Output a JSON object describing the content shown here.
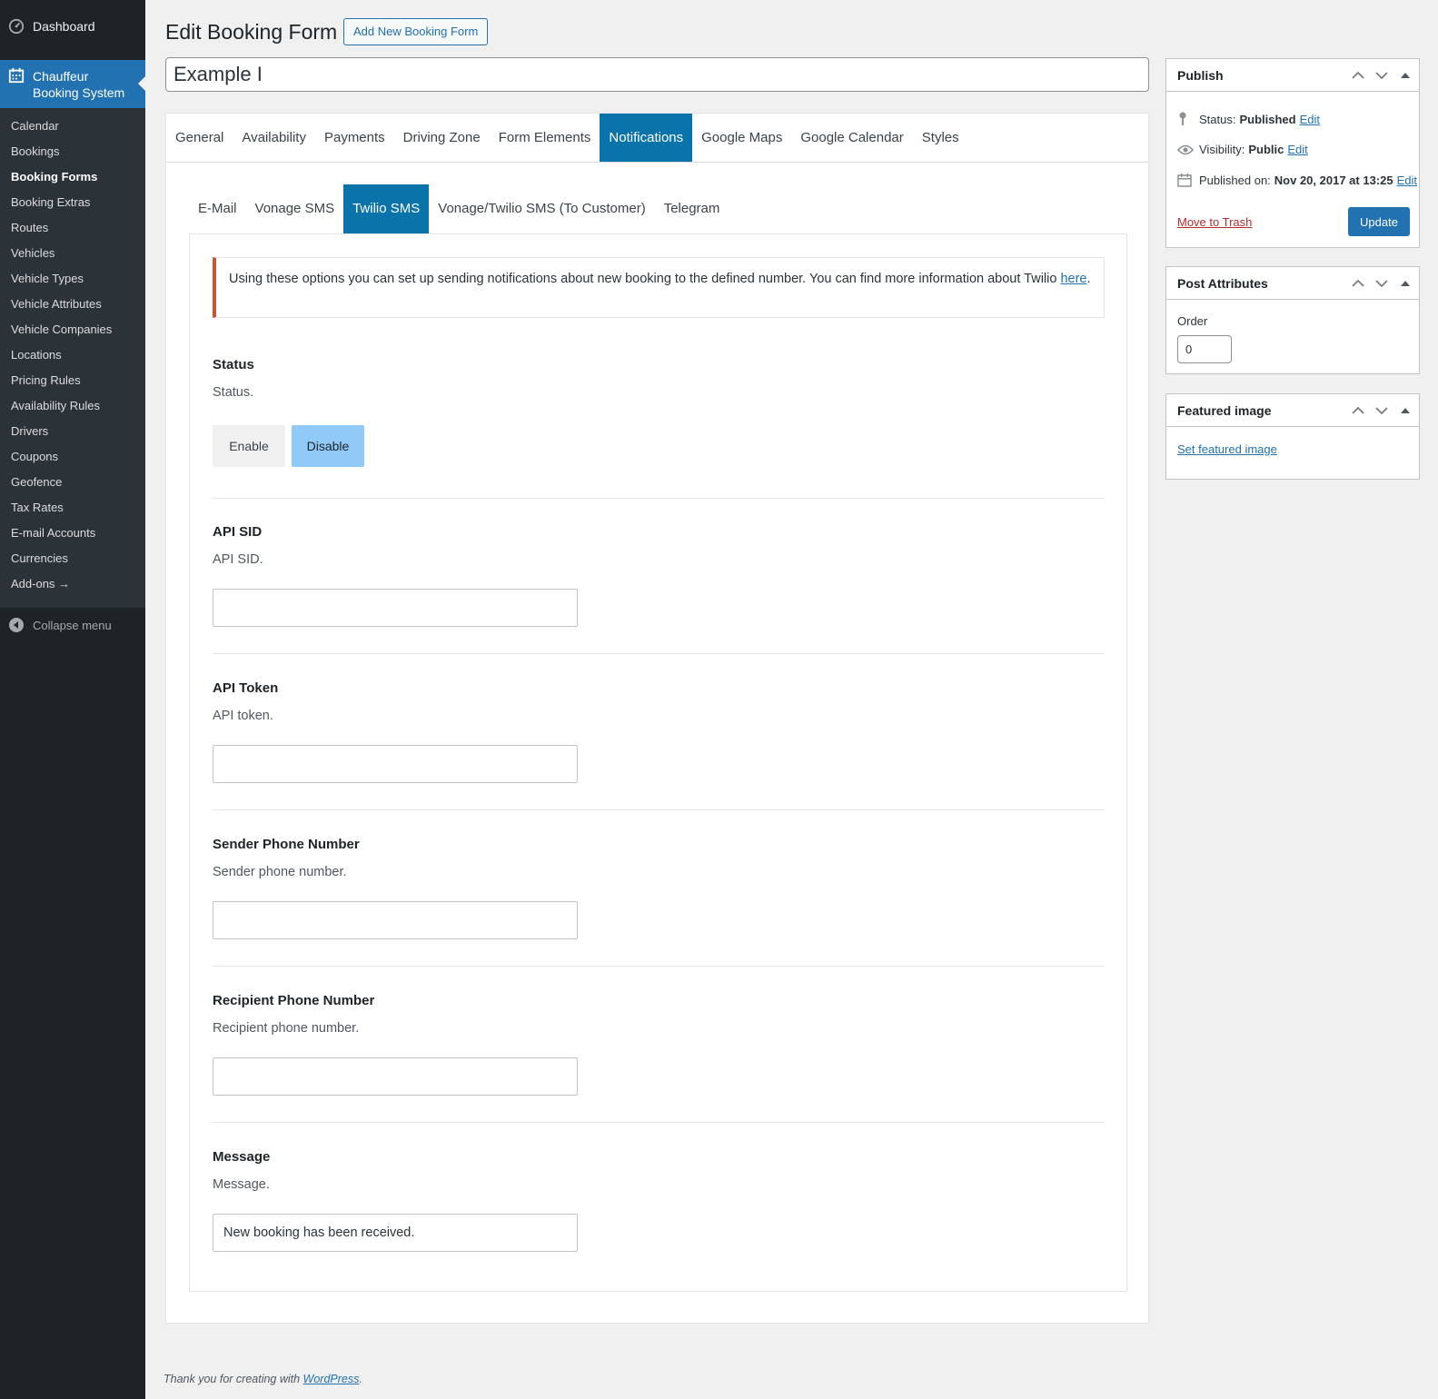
{
  "sidebar": {
    "dashboard": "Dashboard",
    "current_menu": "Chauffeur Booking System",
    "items": [
      {
        "label": "Calendar"
      },
      {
        "label": "Bookings"
      },
      {
        "label": "Booking Forms",
        "current": true
      },
      {
        "label": "Booking Extras"
      },
      {
        "label": "Routes"
      },
      {
        "label": "Vehicles"
      },
      {
        "label": "Vehicle Types"
      },
      {
        "label": "Vehicle Attributes"
      },
      {
        "label": "Vehicle Companies"
      },
      {
        "label": "Locations"
      },
      {
        "label": "Pricing Rules"
      },
      {
        "label": "Availability Rules"
      },
      {
        "label": "Drivers"
      },
      {
        "label": "Coupons"
      },
      {
        "label": "Geofence"
      },
      {
        "label": "Tax Rates"
      },
      {
        "label": "E-mail Accounts"
      },
      {
        "label": "Currencies"
      },
      {
        "label": "Add-ons →"
      }
    ],
    "collapse": "Collapse menu"
  },
  "header": {
    "title": "Edit Booking Form",
    "add_new": "Add New Booking Form",
    "post_title": "Example I"
  },
  "tabs": [
    "General",
    "Availability",
    "Payments",
    "Driving Zone",
    "Form Elements",
    "Notifications",
    "Google Maps",
    "Google Calendar",
    "Styles"
  ],
  "active_tab": "Notifications",
  "subtabs": [
    "E-Mail",
    "Vonage SMS",
    "Twilio SMS",
    "Vonage/Twilio SMS (To Customer)",
    "Telegram"
  ],
  "active_subtab": "Twilio SMS",
  "notice": {
    "text": "Using these options you can set up sending notifications about new booking to the defined number. You can find more information about Twilio ",
    "link": "here",
    "end": "."
  },
  "fields": {
    "status": {
      "title": "Status",
      "desc": "Status.",
      "enable": "Enable",
      "disable": "Disable",
      "selected": "Disable"
    },
    "api_sid": {
      "title": "API SID",
      "desc": "API SID.",
      "value": ""
    },
    "api_token": {
      "title": "API Token",
      "desc": "API token.",
      "value": ""
    },
    "sender": {
      "title": "Sender Phone Number",
      "desc": "Sender phone number.",
      "value": ""
    },
    "recipient": {
      "title": "Recipient Phone Number",
      "desc": "Recipient phone number.",
      "value": ""
    },
    "message": {
      "title": "Message",
      "desc": "Message.",
      "value": "New booking has been received."
    }
  },
  "publish": {
    "title": "Publish",
    "status_label": "Status:",
    "status_value": "Published",
    "visibility_label": "Visibility:",
    "visibility_value": "Public",
    "published_label": "Published on:",
    "published_value": "Nov 20, 2017 at 13:25",
    "edit": "Edit",
    "trash": "Move to Trash",
    "update": "Update"
  },
  "post_attributes": {
    "title": "Post Attributes",
    "order_label": "Order",
    "order_value": "0"
  },
  "featured_image": {
    "title": "Featured image",
    "link": "Set featured image"
  },
  "footer": {
    "text": "Thank you for creating with ",
    "link": "WordPress",
    "end": "."
  },
  "colors": {
    "accent": "#2271b1",
    "tab_active": "#0a73aa",
    "sidebar": "#1d2327",
    "notice_border": "#c9582f",
    "disable_selected": "#90caf9"
  }
}
